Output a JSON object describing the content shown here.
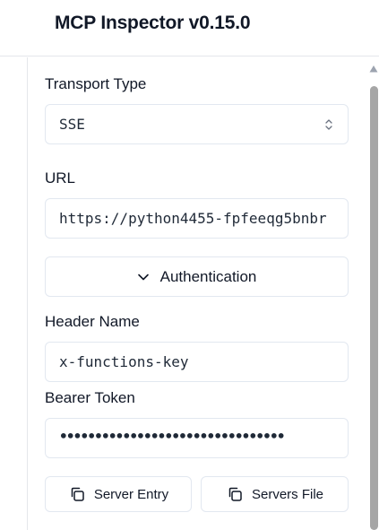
{
  "app": {
    "title": "MCP Inspector v0.15.0"
  },
  "connection": {
    "transport_label": "Transport Type",
    "transport_value": "SSE",
    "url_label": "URL",
    "url_value": "https://python4455-fpfeeqg5bnbr",
    "auth_button_label": "Authentication",
    "header_name_label": "Header Name",
    "header_name_value": "x-functions-key",
    "bearer_token_label": "Bearer Token",
    "bearer_token_value": "••••••••••••••••••••••••••••••••"
  },
  "actions": {
    "server_entry_label": "Server Entry",
    "servers_file_label": "Servers File"
  },
  "icons": {
    "select": "chevron-up-down-icon",
    "auth": "chevron-down-icon",
    "copy": "copy-icon",
    "scroll": "scroll-up-arrow-icon"
  },
  "colors": {
    "border": "#e2e8f0",
    "text": "#111827",
    "scrollbar_thumb": "#a6a6a6"
  }
}
